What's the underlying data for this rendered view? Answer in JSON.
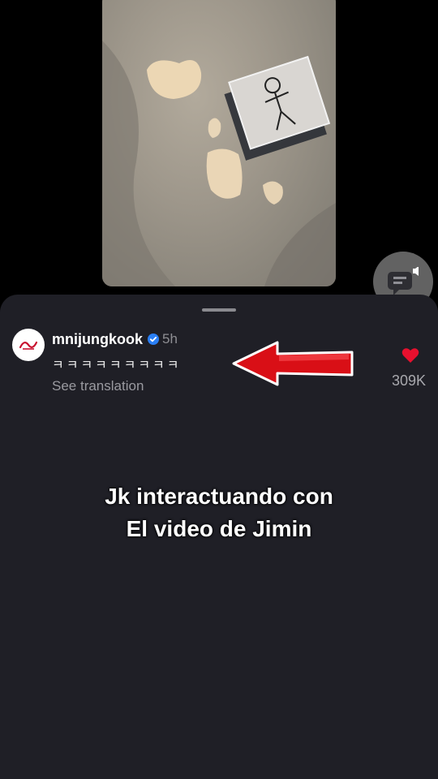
{
  "comment": {
    "username": "mnijungkook",
    "time_ago": "5h",
    "text": "ㅋㅋㅋㅋㅋㅋㅋㅋㅋ",
    "see_translation": "See translation",
    "like_count": "309K"
  },
  "overlay_caption": {
    "line1": "Jk interactuando con",
    "line2": "El video de Jimin"
  },
  "colors": {
    "sheet_bg": "#1f1f26",
    "like_red": "#e8102e",
    "verified_blue": "#2a7ff5",
    "arrow_red": "#d90f16"
  },
  "icons": {
    "verified": "verified-badge-icon",
    "like": "heart-icon",
    "sound": "speaker-chat-icon"
  }
}
